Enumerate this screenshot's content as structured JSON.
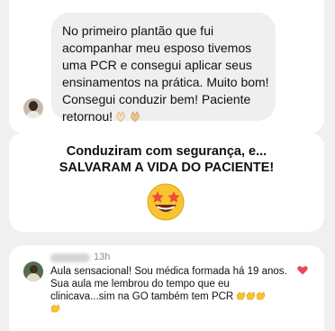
{
  "message": {
    "text": "No primeiro plantão que fui\nacompanhar meu esposo tivemos\numa PCR e consegui aplicar seus\nensinamentos na prática. Muito bom!\nConsegui conduzir bem! Paciente\nretornou!"
  },
  "headline": {
    "line1": "Conduziram com segurança, e...",
    "line2": "SALVARAM A VIDA DO PACIENTE!"
  },
  "comment": {
    "time": "13h",
    "text": "Aula sensacional! Sou médica formada há 19 anos.  Sua aula me lembrou do tempo que eu clinicava...sim na GO também tem PCR "
  },
  "icons": {
    "praying_hands": "praying-hands-emoji",
    "star_struck": "star-struck-emoji",
    "clapping": "clapping-hands-emoji",
    "like": "heart-icon"
  },
  "colors": {
    "bubble": "#efefef",
    "like": "#ed4956",
    "meta": "#8e8e8e"
  }
}
